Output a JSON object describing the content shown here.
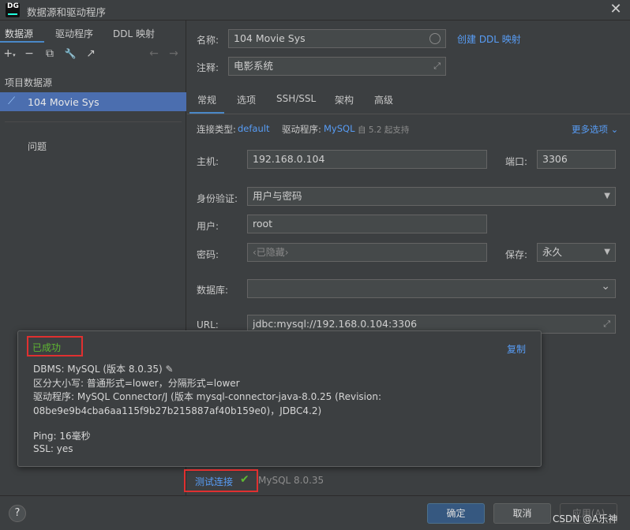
{
  "window": {
    "title": "数据源和驱动程序",
    "app_icon_text": "DG",
    "close_glyph": "✕"
  },
  "sidebar": {
    "tabs": [
      "数据源",
      "驱动程序",
      "DDL 映射"
    ],
    "toolbar": {
      "add": "+",
      "add_caret": "▾",
      "remove": "−",
      "duplicate": "⧉",
      "settings": "🔧",
      "jump": "↗",
      "back": "←",
      "forward": "→"
    },
    "section_label": "项目数据源",
    "datasource_icon": "⟋",
    "datasource": "104 Movie Sys",
    "problems": "问题"
  },
  "form": {
    "name_label": "名称:",
    "name_value": "104 Movie Sys",
    "create_ddl_link": "创建 DDL 映射",
    "comment_label": "注释:",
    "comment_value": "电影系统",
    "expand_glyph": "⤢",
    "subtabs": [
      "常规",
      "选项",
      "SSH/SSL",
      "架构",
      "高级"
    ],
    "conn_type_label": "连接类型:",
    "conn_type_value": "default",
    "driver_label": "驱动程序:",
    "driver_value": "MySQL",
    "driver_note": "自 5.2 起支持",
    "more_options": "更多选项",
    "more_options_caret": "⌄",
    "host_label": "主机:",
    "host_value": "192.168.0.104",
    "port_label": "端口:",
    "port_value": "3306",
    "auth_label": "身份验证:",
    "auth_value": "用户与密码",
    "user_label": "用户:",
    "user_value": "root",
    "password_label": "密码:",
    "password_placeholder": "‹已隐藏›",
    "save_label": "保存:",
    "save_value": "永久",
    "database_label": "数据库:",
    "database_value": "",
    "url_label": "URL:",
    "url_value": "jdbc:mysql://192.168.0.104:3306",
    "dropdown_glyph": "▼",
    "chevron_glyph": "⌄"
  },
  "popup": {
    "status": "已成功",
    "copy": "复制",
    "lines": [
      "DBMS: MySQL (版本 8.0.35)",
      "区分大小写: 普通形式=lower，分隔形式=lower",
      "驱动程序: MySQL Connector/J (版本 mysql-connector-java-8.0.25 (Revision:",
      "08be9e9b4cba6aa115f9b27b215887af40b159e0)，JDBC4.2)",
      "Ping: 16毫秒",
      "SSL: yes"
    ],
    "edit_glyph": "✎"
  },
  "test": {
    "label": "测试连接",
    "check_glyph": "✔",
    "version": "MySQL 8.0.35"
  },
  "footer": {
    "help": "?",
    "ok": "确定",
    "cancel": "取消",
    "apply": "应用(A)",
    "watermark": "CSDN @A乐神"
  },
  "colors": {
    "accent": "#4b6eaf",
    "link": "#589df6",
    "success": "#5fb832",
    "highlight": "#e03030"
  }
}
